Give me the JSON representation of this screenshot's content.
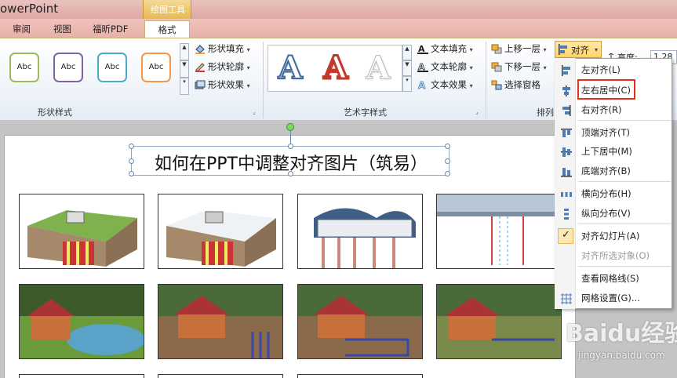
{
  "app": {
    "title": "owerPoint",
    "context_group": "绘图工具"
  },
  "tabs": [
    {
      "label": "审阅"
    },
    {
      "label": "视图"
    },
    {
      "label": "福昕PDF"
    },
    {
      "label": "格式"
    }
  ],
  "ribbon": {
    "shape_styles": {
      "samples": [
        "Abc",
        "Abc",
        "Abc",
        "Abc"
      ],
      "sample_colors": [
        "#9bbb59",
        "#8064a2",
        "#4bacc6",
        "#f79646"
      ],
      "fill": "形状填充",
      "outline": "形状轮廓",
      "effect": "形状效果",
      "title": "形状样式"
    },
    "wordart": {
      "samples": [
        "A",
        "A",
        "A"
      ],
      "text_fill": "文本填充",
      "text_outline": "文本轮廓",
      "text_effect": "文本效果",
      "title": "艺术字样式"
    },
    "arrange": {
      "bring_forward": "上移一层",
      "send_backward": "下移一层",
      "selection_pane": "选择窗格",
      "align": "对齐",
      "title": "排列",
      "height_label": "高度:",
      "height_value": "1.28"
    }
  },
  "slide": {
    "title": "如何在PPT中调整对齐图片（筑易）"
  },
  "align_menu": [
    {
      "label": "左对齐(L)",
      "enabled": true
    },
    {
      "label": "左右居中(C)",
      "enabled": true,
      "highlighted": true
    },
    {
      "label": "右对齐(R)",
      "enabled": true
    },
    {
      "label": "顶端对齐(T)",
      "enabled": true
    },
    {
      "label": "上下居中(M)",
      "enabled": true
    },
    {
      "label": "底端对齐(B)",
      "enabled": true
    },
    {
      "label": "横向分布(H)",
      "enabled": true
    },
    {
      "label": "纵向分布(V)",
      "enabled": true
    },
    {
      "label": "对齐幻灯片(A)",
      "enabled": true,
      "checked": true
    },
    {
      "label": "对齐所选对象(O)",
      "enabled": false
    },
    {
      "label": "查看网格线(S)",
      "enabled": true
    },
    {
      "label": "网格设置(G)...",
      "enabled": true
    }
  ],
  "watermark": {
    "brand": "Baidu经验",
    "url": "jingyan.baidu.com"
  },
  "colors": {
    "accent": "#e0301c",
    "ribbon_tab": "#e6b1a9",
    "context": "#e8b94f"
  }
}
